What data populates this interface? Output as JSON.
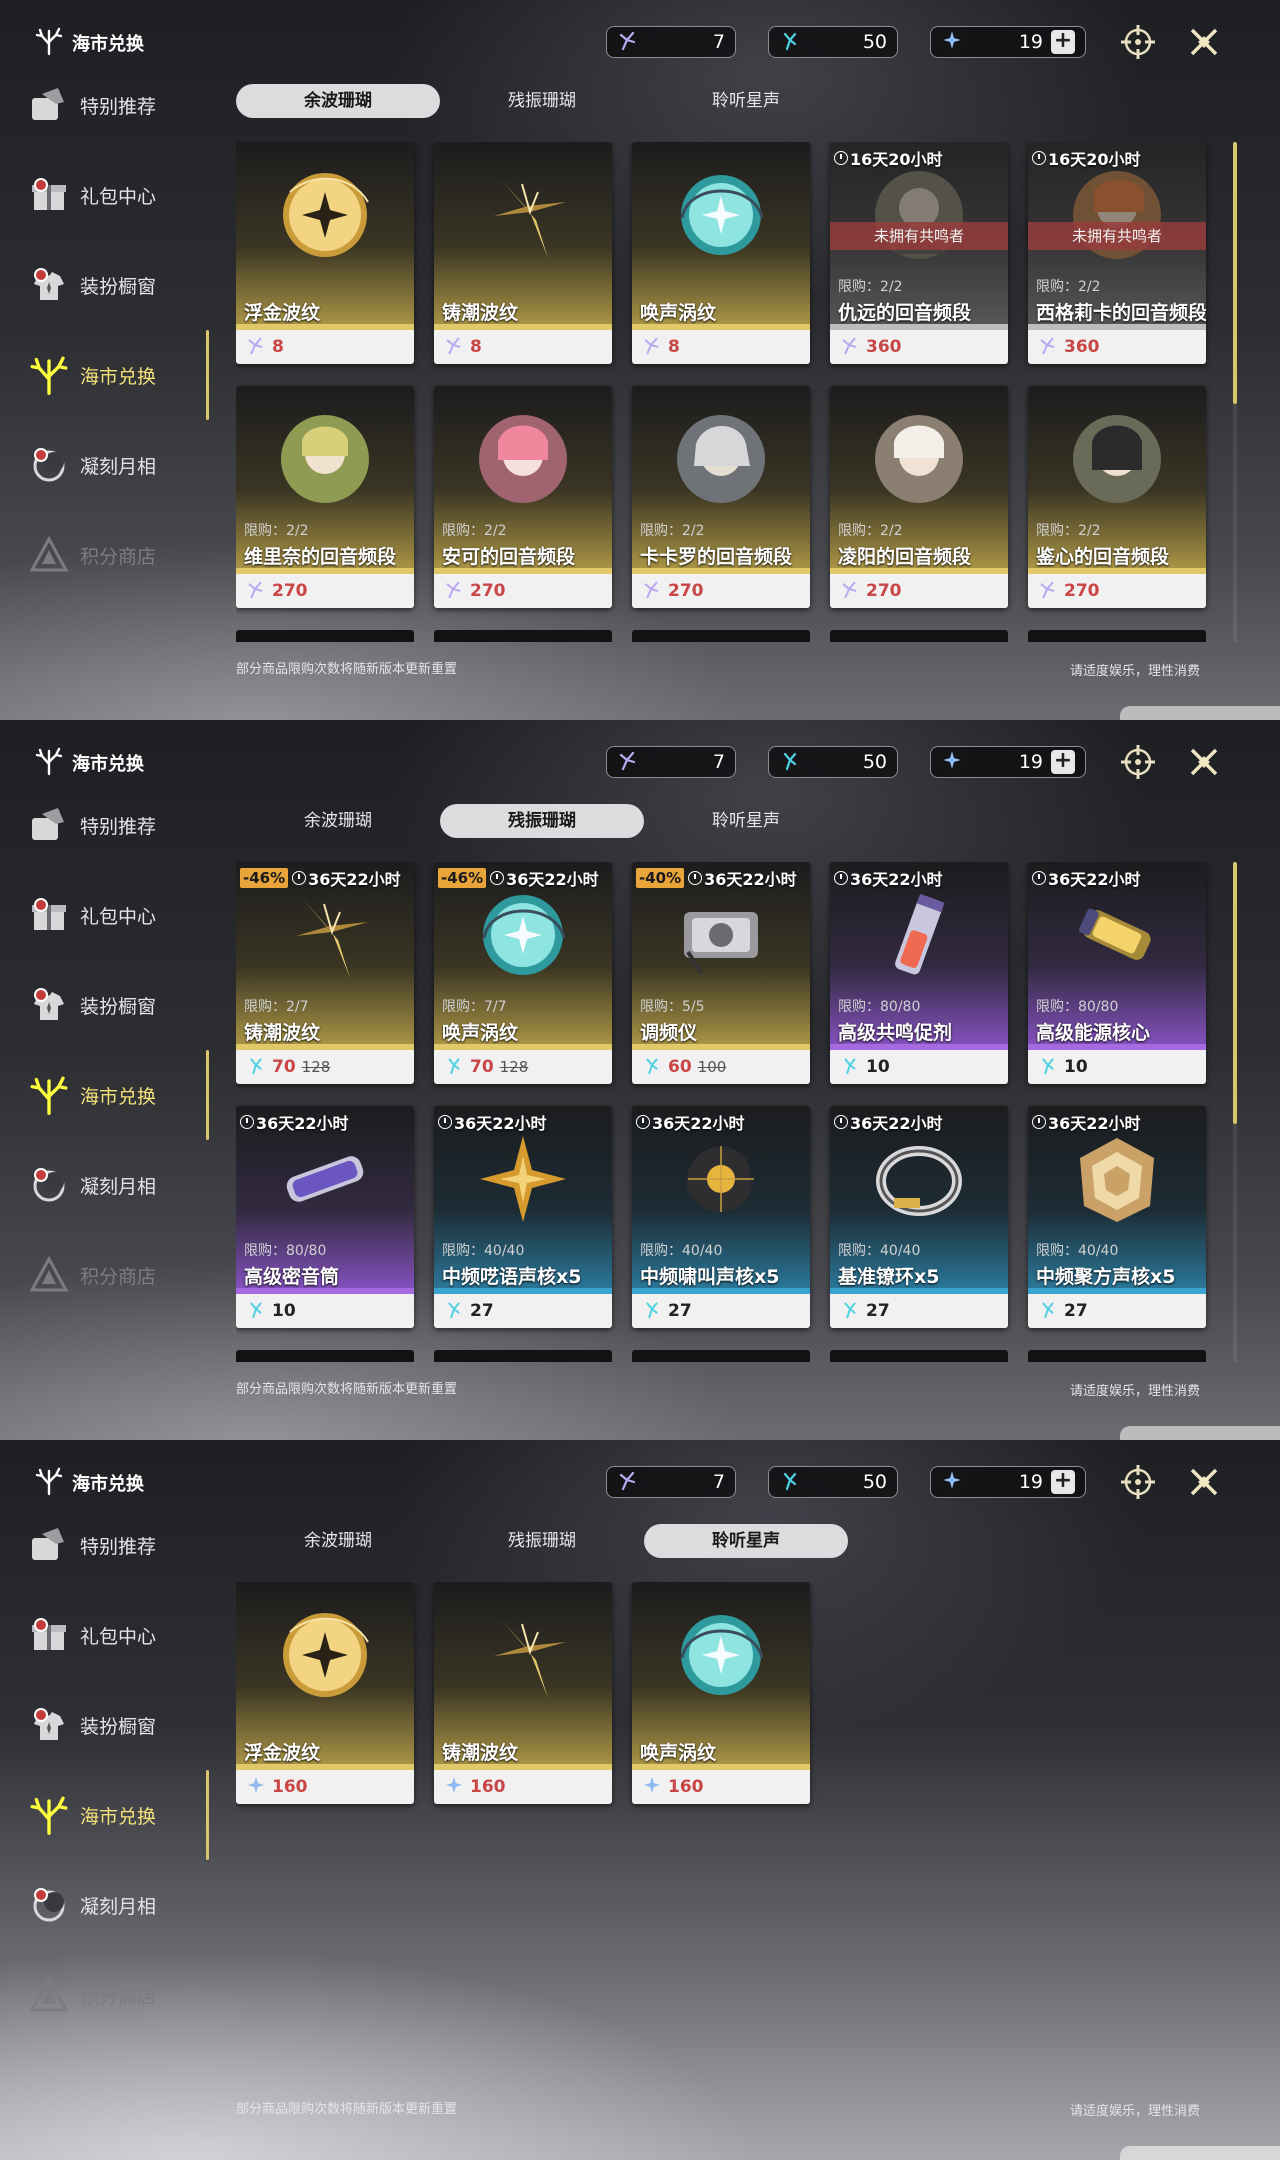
{
  "colors": {
    "accent_gold": "#e1c96a",
    "accent_purple": "#a56ae0",
    "accent_blue": "#3aa4d0",
    "discount": "#e9a43a",
    "sold_out_banner": "#963c3c"
  },
  "header": {
    "title": "海市兑换",
    "title_icon": "coral-icon",
    "currencies": [
      {
        "icon": "wave-coral-icon",
        "value": "7"
      },
      {
        "icon": "echo-coral-icon",
        "value": "50"
      },
      {
        "icon": "star-sound-icon",
        "value": "19",
        "plus": "+"
      }
    ],
    "buttons": [
      "crosshair-icon",
      "close-icon"
    ]
  },
  "sidebar": {
    "items": [
      {
        "label": "特别推荐",
        "icon": "recommend-icon",
        "dot": false
      },
      {
        "label": "礼包中心",
        "icon": "gift-icon",
        "dot": true
      },
      {
        "label": "装扮橱窗",
        "icon": "outfit-icon",
        "dot": true
      },
      {
        "label": "海市兑换",
        "icon": "coral-icon",
        "active": true
      },
      {
        "label": "凝刻月相",
        "icon": "moon-icon",
        "dot": true
      },
      {
        "label": "积分商店",
        "icon": "points-icon",
        "dim": true
      }
    ]
  },
  "tabs": [
    "余波珊瑚",
    "残振珊瑚",
    "聆听星声"
  ],
  "footer": {
    "left": "部分商品限购次数将随新版本更新重置",
    "right": "请适度娱乐，理性消费"
  },
  "screens": [
    {
      "selected_tab": 0,
      "cards": [
        {
          "name": "浮金波纹",
          "price": "8",
          "price_icon": "wave-coral-icon",
          "price_red": true,
          "theme": "gold",
          "art": "gold-orb"
        },
        {
          "name": "铸潮波纹",
          "price": "8",
          "price_icon": "wave-coral-icon",
          "price_red": true,
          "theme": "gold",
          "art": "blade"
        },
        {
          "name": "唤声涡纹",
          "price": "8",
          "price_icon": "wave-coral-icon",
          "price_red": true,
          "theme": "gold",
          "art": "teal-orb"
        },
        {
          "name": "仇远的回音频段",
          "price": "360",
          "price_icon": "wave-coral-icon",
          "price_red": true,
          "theme": "grey",
          "art": "portrait",
          "timer": "16天20小时",
          "banner": "未拥有共鸣者",
          "limit": "限购：2/2"
        },
        {
          "name": "西格莉卡的回音频段",
          "price": "360",
          "price_icon": "wave-coral-icon",
          "price_red": true,
          "theme": "grey",
          "art": "portrait-orange",
          "timer": "16天20小时",
          "banner": "未拥有共鸣者",
          "limit": "限购：2/2"
        },
        {
          "name": "维里奈的回音频段",
          "price": "270",
          "price_icon": "wave-coral-icon",
          "price_red": true,
          "theme": "gold",
          "art": "portrait-green",
          "limit": "限购：2/2"
        },
        {
          "name": "安可的回音频段",
          "price": "270",
          "price_icon": "wave-coral-icon",
          "price_red": true,
          "theme": "gold",
          "art": "portrait-pink",
          "limit": "限购：2/2"
        },
        {
          "name": "卡卡罗的回音频段",
          "price": "270",
          "price_icon": "wave-coral-icon",
          "price_red": true,
          "theme": "gold",
          "art": "portrait-silver",
          "limit": "限购：2/2"
        },
        {
          "name": "凌阳的回音频段",
          "price": "270",
          "price_icon": "wave-coral-icon",
          "price_red": true,
          "theme": "gold",
          "art": "portrait-white",
          "limit": "限购：2/2"
        },
        {
          "name": "鉴心的回音频段",
          "price": "270",
          "price_icon": "wave-coral-icon",
          "price_red": true,
          "theme": "gold",
          "art": "portrait-dark",
          "limit": "限购：2/2"
        }
      ]
    },
    {
      "selected_tab": 1,
      "cards": [
        {
          "name": "铸潮波纹",
          "price": "70",
          "old_price": "128",
          "price_icon": "echo-coral-icon",
          "price_red": true,
          "theme": "gold",
          "art": "blade",
          "timer": "36天22小时",
          "discount": "-46%",
          "limit": "限购：2/7"
        },
        {
          "name": "唤声涡纹",
          "price": "70",
          "old_price": "128",
          "price_icon": "echo-coral-icon",
          "price_red": true,
          "theme": "gold",
          "art": "teal-orb",
          "timer": "36天22小时",
          "discount": "-46%",
          "limit": "限购：7/7"
        },
        {
          "name": "调频仪",
          "price": "60",
          "old_price": "100",
          "price_icon": "echo-coral-icon",
          "price_red": true,
          "theme": "gold",
          "art": "device",
          "timer": "36天22小时",
          "discount": "-40%",
          "limit": "限购：5/5"
        },
        {
          "name": "高级共鸣促剂",
          "price": "10",
          "price_icon": "echo-coral-icon",
          "theme": "purple",
          "art": "vial",
          "timer": "36天22小时",
          "limit": "限购：80/80"
        },
        {
          "name": "高级能源核心",
          "price": "10",
          "price_icon": "echo-coral-icon",
          "theme": "purple",
          "art": "cell",
          "timer": "36天22小时",
          "limit": "限购：80/80"
        },
        {
          "name": "高级密音筒",
          "price": "10",
          "price_icon": "echo-coral-icon",
          "theme": "purple",
          "art": "tube",
          "timer": "36天22小时",
          "limit": "限购：80/80"
        },
        {
          "name": "中频呓语声核x5",
          "price": "27",
          "price_icon": "echo-coral-icon",
          "theme": "blue",
          "art": "star-core",
          "timer": "36天22小时",
          "limit": "限购：40/40"
        },
        {
          "name": "中频啸叫声核x5",
          "price": "27",
          "price_icon": "echo-coral-icon",
          "theme": "blue",
          "art": "dark-core",
          "timer": "36天22小时",
          "limit": "限购：40/40"
        },
        {
          "name": "基准镣环x5",
          "price": "27",
          "price_icon": "echo-coral-icon",
          "theme": "blue",
          "art": "ring",
          "timer": "36天22小时",
          "limit": "限购：40/40"
        },
        {
          "name": "中频聚方声核x5",
          "price": "27",
          "price_icon": "echo-coral-icon",
          "theme": "blue",
          "art": "polygon",
          "timer": "36天22小时",
          "limit": "限购：40/40"
        }
      ]
    },
    {
      "selected_tab": 2,
      "cards": [
        {
          "name": "浮金波纹",
          "price": "160",
          "price_icon": "star-sound-icon",
          "price_red": true,
          "theme": "gold",
          "art": "gold-orb"
        },
        {
          "name": "铸潮波纹",
          "price": "160",
          "price_icon": "star-sound-icon",
          "price_red": true,
          "theme": "gold",
          "art": "blade"
        },
        {
          "name": "唤声涡纹",
          "price": "160",
          "price_icon": "star-sound-icon",
          "price_red": true,
          "theme": "gold",
          "art": "teal-orb"
        }
      ]
    }
  ]
}
